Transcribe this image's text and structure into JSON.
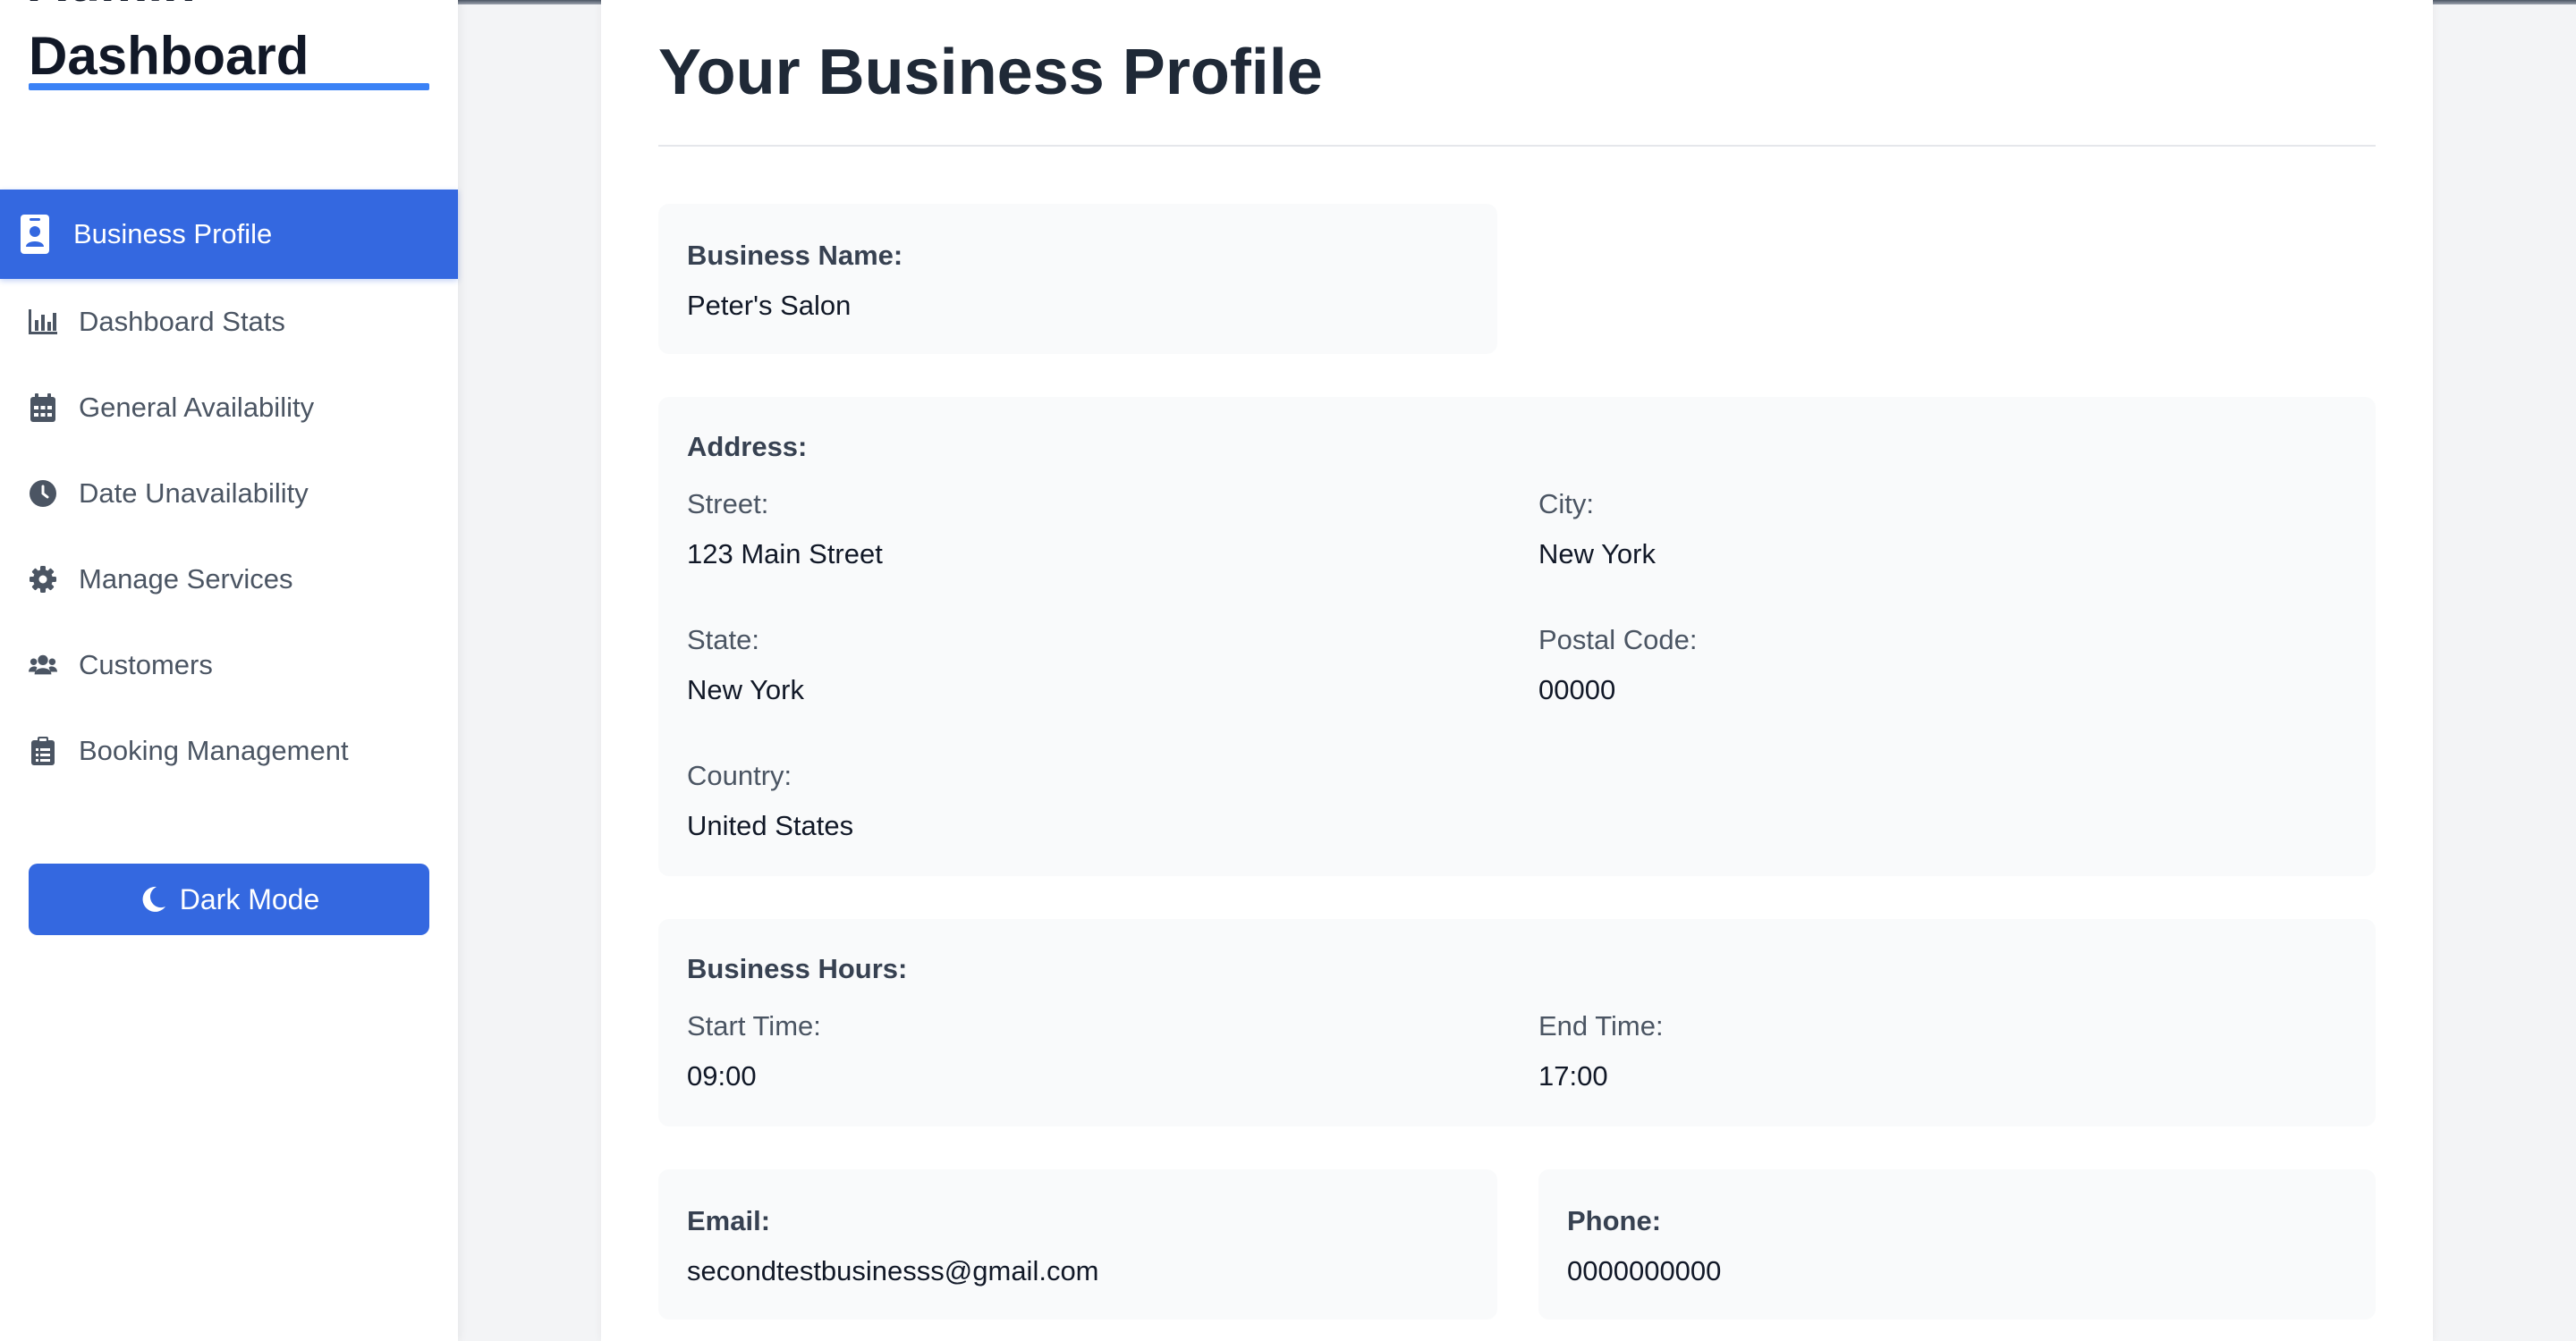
{
  "sidebar": {
    "brand_line1": "Admin",
    "brand_line2": "Dashboard",
    "items": [
      {
        "label": "Business Profile",
        "icon": "id-badge-icon"
      },
      {
        "label": "Dashboard Stats",
        "icon": "bar-chart-icon"
      },
      {
        "label": "General Availability",
        "icon": "calendar-icon"
      },
      {
        "label": "Date Unavailability",
        "icon": "clock-icon"
      },
      {
        "label": "Manage Services",
        "icon": "gear-icon"
      },
      {
        "label": "Customers",
        "icon": "users-icon"
      },
      {
        "label": "Booking Management",
        "icon": "clipboard-icon"
      }
    ],
    "dark_mode_label": "Dark Mode"
  },
  "main": {
    "title": "Your Business Profile",
    "business_name": {
      "label": "Business Name:",
      "value": "Peter's Salon"
    },
    "address": {
      "label": "Address:",
      "street_label": "Street:",
      "street": "123 Main Street",
      "city_label": "City:",
      "city": "New York",
      "state_label": "State:",
      "state": "New York",
      "postal_label": "Postal Code:",
      "postal": "00000",
      "country_label": "Country:",
      "country": "United States"
    },
    "hours": {
      "label": "Business Hours:",
      "start_label": "Start Time:",
      "start": "09:00",
      "end_label": "End Time:",
      "end": "17:00"
    },
    "email": {
      "label": "Email:",
      "value": "secondtestbusinesss@gmail.com"
    },
    "phone": {
      "label": "Phone:",
      "value": "0000000000"
    }
  },
  "colors": {
    "accent": "#3468e0",
    "underline": "#3b82f6",
    "panel_bg": "#f9fafb"
  }
}
